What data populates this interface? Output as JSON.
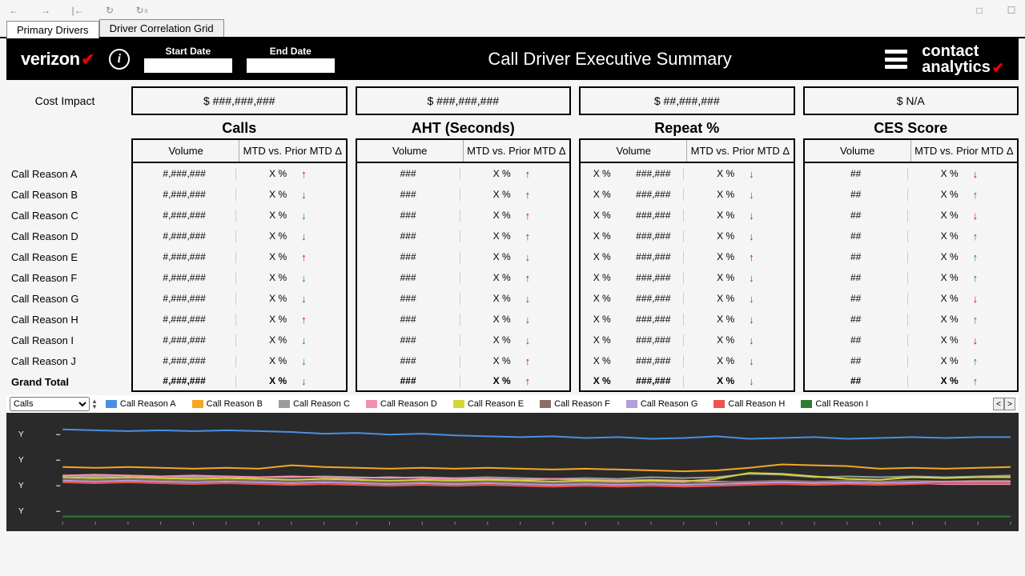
{
  "toolbar": {
    "icons": [
      "back",
      "forward",
      "first",
      "refresh",
      "refresh-pause",
      "comment",
      "fullscreen"
    ]
  },
  "tabs": [
    {
      "label": "Primary Drivers",
      "active": true
    },
    {
      "label": "Driver Correlation Grid",
      "active": false
    }
  ],
  "header": {
    "logo": "verizon",
    "start_label": "Start Date",
    "end_label": "End Date",
    "start_value": "",
    "end_value": "",
    "title": "Call Driver Executive Summary",
    "brand2_line1": "contact",
    "brand2_line2": "analytics"
  },
  "cost": {
    "label": "Cost Impact",
    "boxes": [
      "$ ###,###,###",
      "$ ###,###,###",
      "$ ##,###,###",
      "$ N/A"
    ]
  },
  "metric_groups": [
    {
      "title": "Calls",
      "sub": [
        "Volume",
        "MTD vs. Prior MTD Δ"
      ]
    },
    {
      "title": "AHT (Seconds)",
      "sub": [
        "Volume",
        "MTD vs. Prior MTD Δ"
      ]
    },
    {
      "title": "Repeat %",
      "sub": [
        "Volume",
        "MTD vs. Prior MTD Δ"
      ]
    },
    {
      "title": "CES Score",
      "sub": [
        "Volume",
        "MTD vs. Prior MTD Δ"
      ]
    }
  ],
  "reasons": [
    "Call Reason A",
    "Call Reason B",
    "Call Reason C",
    "Call Reason D",
    "Call Reason E",
    "Call Reason F",
    "Call Reason G",
    "Call Reason H",
    "Call Reason I",
    "Call Reason J",
    "Grand Total"
  ],
  "rows": [
    {
      "calls_vol": "#,###,###",
      "calls_pct": "X %",
      "calls_dir": "up",
      "aht_vol": "###",
      "aht_pct": "X %",
      "aht_dir": "up",
      "rpt_v1": "X %",
      "rpt_v2": "###,###",
      "rpt_pct": "X %",
      "rpt_dir": "down",
      "ces_vol": "##",
      "ces_pct": "X %",
      "ces_dir": "up-red"
    },
    {
      "calls_vol": "#,###,###",
      "calls_pct": "X %",
      "calls_dir": "down",
      "aht_vol": "###",
      "aht_pct": "X %",
      "aht_dir": "up",
      "rpt_v1": "X %",
      "rpt_v2": "###,###",
      "rpt_pct": "X %",
      "rpt_dir": "down",
      "ces_vol": "##",
      "ces_pct": "X %",
      "ces_dir": "down-green"
    },
    {
      "calls_vol": "#,###,###",
      "calls_pct": "X %",
      "calls_dir": "down",
      "aht_vol": "###",
      "aht_pct": "X %",
      "aht_dir": "up",
      "rpt_v1": "X %",
      "rpt_v2": "###,###",
      "rpt_pct": "X %",
      "rpt_dir": "down",
      "ces_vol": "##",
      "ces_pct": "X %",
      "ces_dir": "up-red"
    },
    {
      "calls_vol": "#,###,###",
      "calls_pct": "X %",
      "calls_dir": "down",
      "aht_vol": "###",
      "aht_pct": "X %",
      "aht_dir": "up",
      "rpt_v1": "X %",
      "rpt_v2": "###,###",
      "rpt_pct": "X %",
      "rpt_dir": "down",
      "ces_vol": "##",
      "ces_pct": "X %",
      "ces_dir": "down-green"
    },
    {
      "calls_vol": "#,###,###",
      "calls_pct": "X %",
      "calls_dir": "up",
      "aht_vol": "###",
      "aht_pct": "X %",
      "aht_dir": "down",
      "rpt_v1": "X %",
      "rpt_v2": "###,###",
      "rpt_pct": "X %",
      "rpt_dir": "up",
      "ces_vol": "##",
      "ces_pct": "X %",
      "ces_dir": "down-green"
    },
    {
      "calls_vol": "#,###,###",
      "calls_pct": "X %",
      "calls_dir": "down",
      "aht_vol": "###",
      "aht_pct": "X %",
      "aht_dir": "up",
      "rpt_v1": "X %",
      "rpt_v2": "###,###",
      "rpt_pct": "X %",
      "rpt_dir": "down",
      "ces_vol": "##",
      "ces_pct": "X %",
      "ces_dir": "down-green"
    },
    {
      "calls_vol": "#,###,###",
      "calls_pct": "X %",
      "calls_dir": "down",
      "aht_vol": "###",
      "aht_pct": "X %",
      "aht_dir": "down",
      "rpt_v1": "X %",
      "rpt_v2": "###,###",
      "rpt_pct": "X %",
      "rpt_dir": "down",
      "ces_vol": "##",
      "ces_pct": "X %",
      "ces_dir": "up-red"
    },
    {
      "calls_vol": "#,###,###",
      "calls_pct": "X %",
      "calls_dir": "up",
      "aht_vol": "###",
      "aht_pct": "X %",
      "aht_dir": "down",
      "rpt_v1": "X %",
      "rpt_v2": "###,###",
      "rpt_pct": "X %",
      "rpt_dir": "down",
      "ces_vol": "##",
      "ces_pct": "X %",
      "ces_dir": "down-green"
    },
    {
      "calls_vol": "#,###,###",
      "calls_pct": "X %",
      "calls_dir": "down",
      "aht_vol": "###",
      "aht_pct": "X %",
      "aht_dir": "down",
      "rpt_v1": "X %",
      "rpt_v2": "###,###",
      "rpt_pct": "X %",
      "rpt_dir": "down",
      "ces_vol": "##",
      "ces_pct": "X %",
      "ces_dir": "up-red"
    },
    {
      "calls_vol": "#,###,###",
      "calls_pct": "X %",
      "calls_dir": "down",
      "aht_vol": "###",
      "aht_pct": "X %",
      "aht_dir": "up",
      "rpt_v1": "X %",
      "rpt_v2": "###,###",
      "rpt_pct": "X %",
      "rpt_dir": "down",
      "ces_vol": "##",
      "ces_pct": "X %",
      "ces_dir": "down-green"
    },
    {
      "calls_vol": "#,###,###",
      "calls_pct": "X %",
      "calls_dir": "down",
      "aht_vol": "###",
      "aht_pct": "X %",
      "aht_dir": "up",
      "rpt_v1": "X %",
      "rpt_v2": "###,###",
      "rpt_pct": "X %",
      "rpt_dir": "down",
      "ces_vol": "##",
      "ces_pct": "X %",
      "ces_dir": "down-green"
    }
  ],
  "chart_selector": {
    "options": [
      "Calls"
    ],
    "value": "Calls"
  },
  "legend": [
    {
      "label": "Call Reason A",
      "color": "#4a90e2"
    },
    {
      "label": "Call Reason B",
      "color": "#f5a623"
    },
    {
      "label": "Call Reason C",
      "color": "#9b9b9b"
    },
    {
      "label": "Call Reason D",
      "color": "#f48fb1"
    },
    {
      "label": "Call Reason E",
      "color": "#d4d638"
    },
    {
      "label": "Call Reason F",
      "color": "#8d6e63"
    },
    {
      "label": "Call Reason G",
      "color": "#b39ddb"
    },
    {
      "label": "Call Reason H",
      "color": "#ef5350"
    },
    {
      "label": "Call Reason I",
      "color": "#2e7d32"
    }
  ],
  "chart_data": {
    "type": "line",
    "x": [
      1,
      2,
      3,
      4,
      5,
      6,
      7,
      8,
      9,
      10,
      11,
      12,
      13,
      14,
      15,
      16,
      17,
      18,
      19,
      20,
      21,
      22,
      23,
      24,
      25,
      26,
      27,
      28,
      29,
      30
    ],
    "yticks": [
      "Y",
      "Y",
      "Y",
      "Y"
    ],
    "ylim": [
      0,
      120
    ],
    "series": [
      {
        "name": "Call Reason A",
        "color": "#4a90e2",
        "values": [
          108,
          107,
          106,
          107,
          106,
          107,
          106,
          105,
          103,
          104,
          102,
          103,
          101,
          100,
          99,
          100,
          98,
          99,
          97,
          98,
          100,
          97,
          98,
          99,
          97,
          98,
          99,
          98,
          99,
          99
        ]
      },
      {
        "name": "Call Reason B",
        "color": "#f5a623",
        "values": [
          64,
          63,
          64,
          63,
          62,
          63,
          62,
          66,
          64,
          63,
          62,
          63,
          62,
          63,
          62,
          61,
          62,
          61,
          60,
          59,
          60,
          63,
          67,
          66,
          65,
          62,
          63,
          62,
          63,
          64
        ]
      },
      {
        "name": "Call Reason C",
        "color": "#9b9b9b",
        "values": [
          54,
          53,
          54,
          53,
          52,
          53,
          52,
          52,
          53,
          52,
          51,
          52,
          51,
          52,
          51,
          50,
          51,
          50,
          52,
          51,
          52,
          56,
          55,
          52,
          53,
          52,
          53,
          52,
          53,
          54
        ]
      },
      {
        "name": "Call Reason D",
        "color": "#f48fb1",
        "values": [
          54,
          55,
          54,
          53,
          54,
          53,
          52,
          53,
          52,
          51,
          52,
          51,
          50,
          50,
          49,
          50,
          49,
          48,
          49,
          48,
          47,
          46,
          47,
          46,
          45,
          46,
          45,
          44,
          44,
          44
        ]
      },
      {
        "name": "Call Reason E",
        "color": "#d4d638",
        "values": [
          52,
          51,
          52,
          51,
          50,
          51,
          50,
          49,
          50,
          49,
          48,
          49,
          48,
          49,
          48,
          47,
          48,
          47,
          48,
          47,
          50,
          57,
          56,
          53,
          50,
          49,
          52,
          51,
          52,
          52
        ]
      },
      {
        "name": "Call Reason F",
        "color": "#8d6e63",
        "values": [
          50,
          49,
          50,
          49,
          48,
          49,
          48,
          47,
          48,
          47,
          46,
          47,
          46,
          47,
          46,
          45,
          46,
          45,
          46,
          45,
          46,
          47,
          48,
          47,
          48,
          47,
          48,
          47,
          48,
          48
        ]
      },
      {
        "name": "Call Reason G",
        "color": "#b39ddb",
        "values": [
          48,
          47,
          48,
          47,
          46,
          47,
          46,
          45,
          46,
          45,
          44,
          45,
          44,
          45,
          44,
          43,
          44,
          43,
          44,
          43,
          44,
          45,
          46,
          45,
          46,
          45,
          46,
          47,
          47,
          47
        ]
      },
      {
        "name": "Call Reason H",
        "color": "#ef5350",
        "values": [
          46,
          45,
          46,
          45,
          44,
          45,
          44,
          43,
          44,
          43,
          42,
          43,
          42,
          43,
          42,
          41,
          42,
          41,
          42,
          41,
          42,
          43,
          44,
          43,
          44,
          43,
          44,
          45,
          45,
          45
        ]
      },
      {
        "name": "Call Reason I",
        "color": "#2e7d32",
        "values": [
          6,
          6,
          6,
          6,
          6,
          6,
          6,
          6,
          6,
          6,
          6,
          6,
          6,
          6,
          6,
          6,
          6,
          6,
          6,
          6,
          6,
          6,
          6,
          6,
          6,
          6,
          6,
          6,
          6,
          6
        ]
      }
    ]
  }
}
